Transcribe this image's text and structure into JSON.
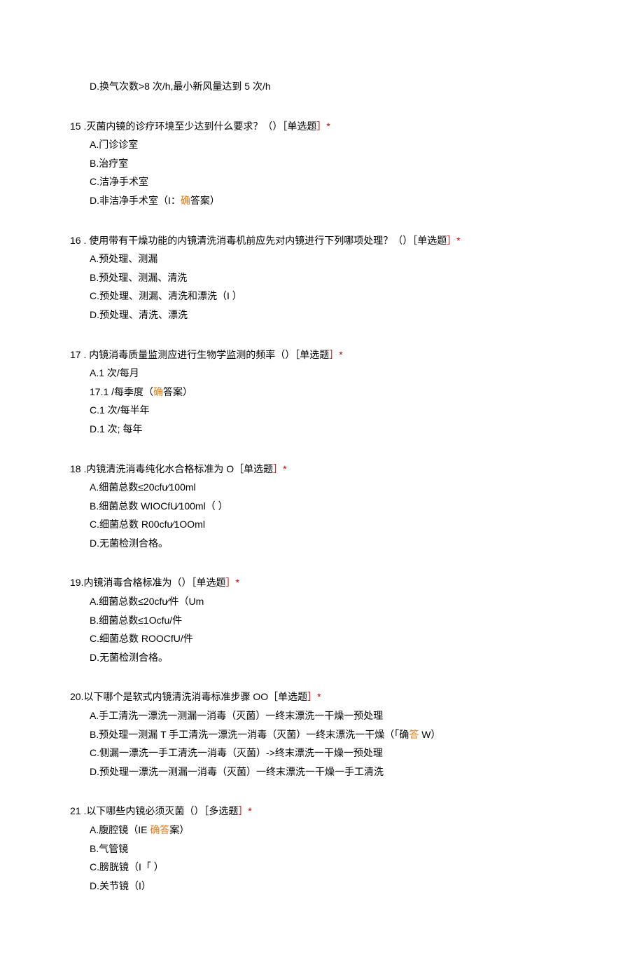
{
  "fragment": {
    "optionD": "D.换气次数>8 次/h,最小新风量达到 5 次/h"
  },
  "q15": {
    "stem_a": "15   .灭菌内镜的诊疗环境至少达到什么要求？（）［单选题",
    "stem_b": "］*",
    "A": "A.门诊诊室",
    "B": "B.治疗室",
    "C": "C.洁净手术室",
    "D_a": "D.非洁净手术室（I：",
    "D_orange": "确",
    "D_b": "答案）"
  },
  "q16": {
    "stem_a": "16   .  使用带有干燥功能的内镜清洗消毒机前应先对内镜进行下列哪项处理？（）［单选题",
    "stem_b": "］*",
    "A": "A.预处理、测漏",
    "B": "B.预处理、测漏、清洗",
    "C": "C.预处理、测漏、清洗和漂洗（I           ）",
    "D": "D.预处理、清洗、漂洗"
  },
  "q17": {
    "stem_a": "17   .  内镜消毒质量监测应进行生物学监测的频率（）［单选题",
    "stem_b": "］*",
    "A": "A.1 次/每月",
    "B_a": "17.1       /每季度（",
    "B_orange": "确",
    "B_b": "答案）",
    "C": "C.1 次/每半年",
    "D": "D.1 次; 每年"
  },
  "q18": {
    "stem_a": "18   .内镜清洗消毒纯化水合格标准为 O［单选题",
    "stem_b": "］*",
    "A": "A.细菌总数≤20cfu∕100ml",
    "B": "B.细菌总数 WIOCfU∕100ml（           ）",
    "C": "C.细菌总数 R00cfu∕1OOml",
    "D": "D.无菌检测合格。"
  },
  "q19": {
    "stem_a": "19.内镜消毒合格标准为（）［单选题",
    "stem_b": "］*",
    "A": "A.细菌总数≤20cfu∕件（Um",
    "B": "B.细菌总数≤1Ocfu/件",
    "C": "C.细菌总数 ROOCfU/件",
    "D": "D.无菌检测合格。"
  },
  "q20": {
    "stem_a": "20.以下哪个是软式内镜清洗消毒标准步骤 OO［单选题",
    "stem_b": "］*",
    "A": "A.手工清洗一漂洗一测漏一消毒（灭菌）一终末漂洗一干燥一预处理",
    "B_a": "B.预处理一测漏 T 手工清洗一漂洗一消毒（灭菌）一终末漂洗一干燥（「确",
    "B_orange": "答",
    "B_b": " W）",
    "C": "C.侧漏一漂洗一手工清洗一消毒（灭菌）->终末漂洗一干燥一预处理",
    "D": "D.预处理一漂洗一测漏一消毒（灭菌）一终末漂洗一干燥一手工清洗"
  },
  "q21": {
    "stem_a": "21   .以下哪些内镜必须灭菌（）［多选题",
    "stem_b": "］*",
    "A_a": "A.腹腔镜（IE ",
    "A_orange": "确答",
    "A_b": "案）",
    "B": "B.气管镜",
    "C": "C.膀胱镜（I「        ）",
    "D": "D.关节镜（I）"
  }
}
